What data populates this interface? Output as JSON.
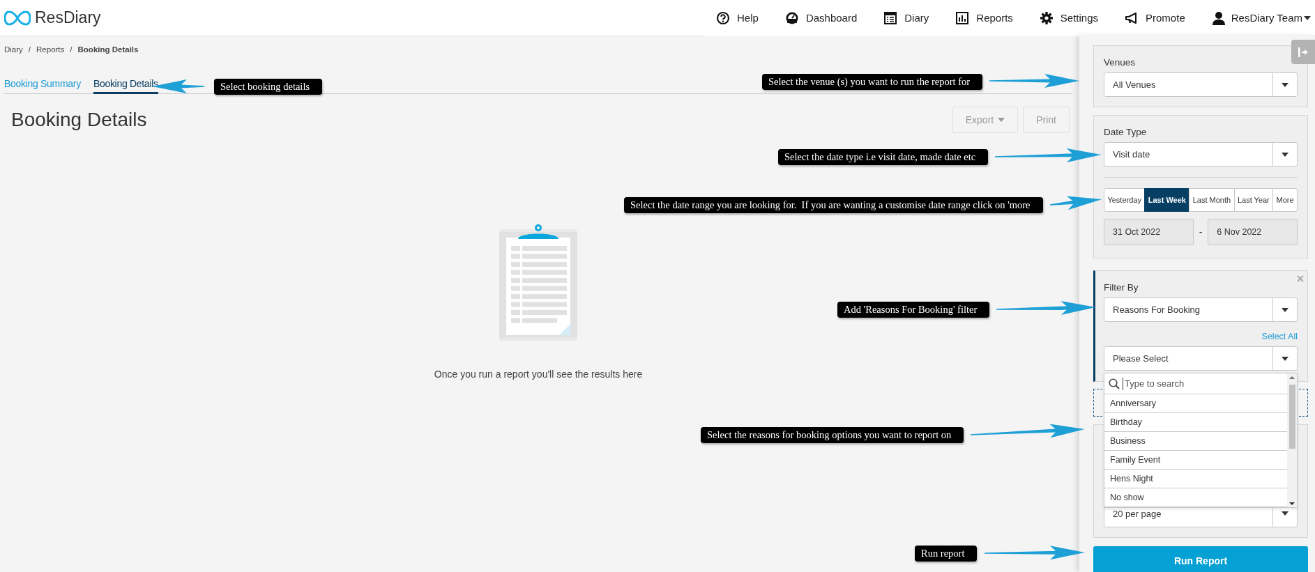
{
  "header": {
    "logo": "ResDiary",
    "nav": [
      {
        "label": "Help"
      },
      {
        "label": "Dashboard"
      },
      {
        "label": "Diary"
      },
      {
        "label": "Reports"
      },
      {
        "label": "Settings"
      },
      {
        "label": "Promote"
      }
    ],
    "user": {
      "label": "ResDiary Team"
    }
  },
  "breadcrumb": {
    "items": [
      {
        "label": "Diary",
        "current": false
      },
      {
        "label": "Reports",
        "current": false
      },
      {
        "label": "Booking Details",
        "current": true
      }
    ],
    "separators": [
      "/",
      "/"
    ]
  },
  "tabs": [
    {
      "label": "Booking Summary",
      "selected": false
    },
    {
      "label": "Booking Details",
      "selected": true
    }
  ],
  "page_title": "Booking Details",
  "actions": [
    {
      "label": "Export",
      "dropdown": true,
      "disabled": true
    },
    {
      "label": "Print",
      "dropdown": false,
      "disabled": true
    }
  ],
  "empty_state": {
    "message": "Once you run a report you'll see the results here"
  },
  "sidebar": {
    "venues": {
      "label": "Venues",
      "value": "All Venues"
    },
    "date_type": {
      "label": "Date Type",
      "value": "Visit date"
    },
    "date_ranges": [
      {
        "label": "Yesterday",
        "selected": false
      },
      {
        "label": "Last Week",
        "selected": true
      },
      {
        "label": "Last Month",
        "selected": false
      },
      {
        "label": "Last Year",
        "selected": false
      },
      {
        "label": "More",
        "selected": false
      }
    ],
    "date_from": "31 Oct 2022",
    "date_separator": "-",
    "date_to": "6 Nov 2022",
    "filter": {
      "label": "Filter By",
      "value": "Reasons For Booking",
      "select_all": "Select All",
      "options_value": "Please Select",
      "search_placeholder": "Type to search",
      "options": [
        {
          "label": "Anniversary"
        },
        {
          "label": "Birthday"
        },
        {
          "label": "Business"
        },
        {
          "label": "Family Event"
        },
        {
          "label": "Hens Night"
        },
        {
          "label": "No show"
        }
      ]
    },
    "page_size": "20 per page",
    "run_button": "Run Report"
  },
  "annotations": [
    {
      "text": "Select booking details"
    },
    {
      "text": "Select the venue (s) you want to run the report for"
    },
    {
      "text": "Select the date type i.e visit date, made date etc"
    },
    {
      "text": "Select the date range you are looking for.  If you are wanting a customise date range click on 'more"
    },
    {
      "text": "Add 'Reasons For Booking' filter"
    },
    {
      "text": "Select the reasons for booking options you want to report on"
    },
    {
      "text": "Run report"
    }
  ]
}
